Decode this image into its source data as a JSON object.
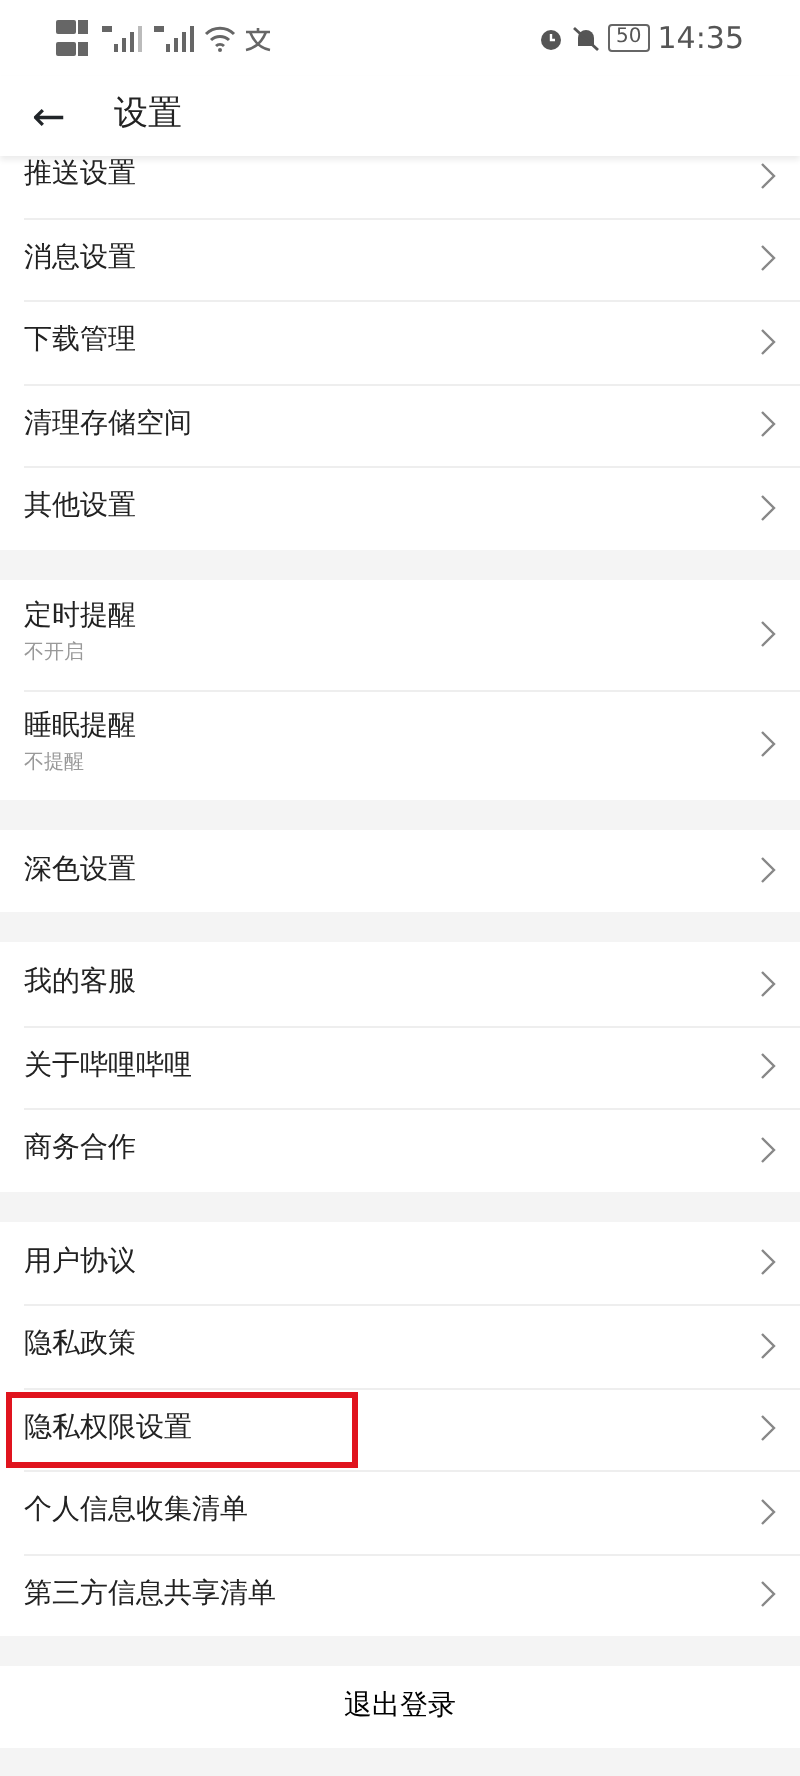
{
  "status_bar": {
    "time": "14:35",
    "battery": "50"
  },
  "header": {
    "back": "←",
    "title": "设置"
  },
  "groups": [
    {
      "items": [
        {
          "label": "推送设置",
          "highlighted": false
        },
        {
          "label": "消息设置",
          "highlighted": false
        },
        {
          "label": "下载管理",
          "highlighted": false
        },
        {
          "label": "清理存储空间",
          "highlighted": false
        },
        {
          "label": "其他设置",
          "highlighted": false
        }
      ]
    },
    {
      "items": [
        {
          "label": "定时提醒",
          "sub": "不开启",
          "highlighted": false
        },
        {
          "label": "睡眠提醒",
          "sub": "不提醒",
          "highlighted": false
        }
      ]
    },
    {
      "items": [
        {
          "label": "深色设置",
          "highlighted": false
        }
      ]
    },
    {
      "items": [
        {
          "label": "我的客服",
          "highlighted": false
        },
        {
          "label": "关于哔哩哔哩",
          "highlighted": false
        },
        {
          "label": "商务合作",
          "highlighted": false
        }
      ]
    },
    {
      "items": [
        {
          "label": "用户协议",
          "highlighted": false
        },
        {
          "label": "隐私政策",
          "highlighted": false
        },
        {
          "label": "隐私权限设置",
          "highlighted": true
        },
        {
          "label": "个人信息收集清单",
          "highlighted": false
        },
        {
          "label": "第三方信息共享清单",
          "highlighted": false
        }
      ]
    }
  ],
  "logout": "退出登录"
}
